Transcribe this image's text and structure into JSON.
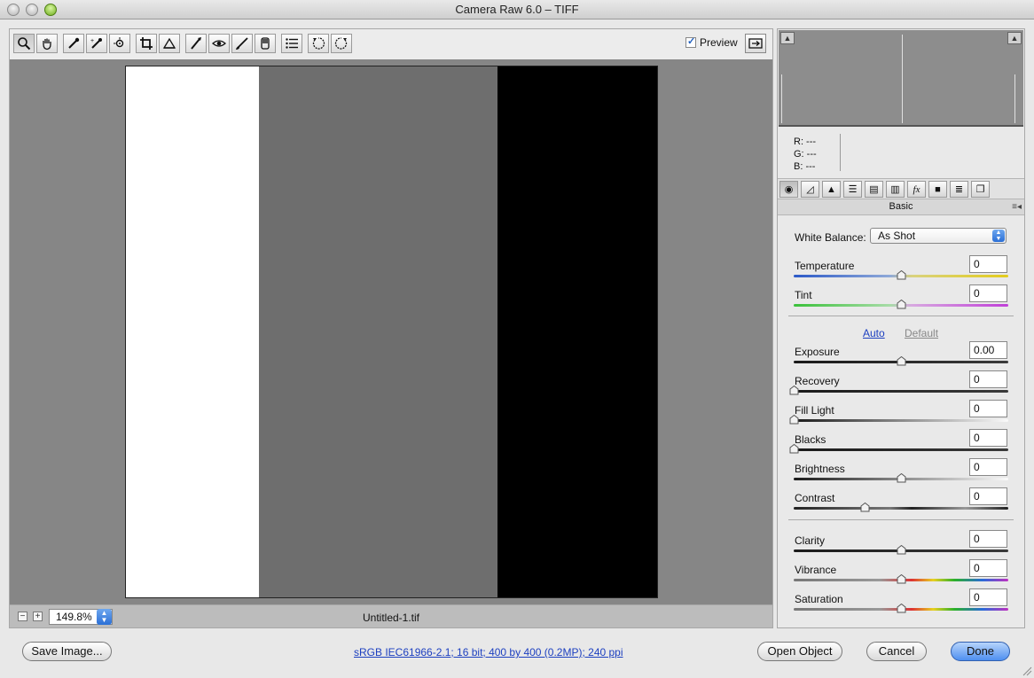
{
  "window": {
    "title": "Camera Raw 6.0  –  TIFF"
  },
  "toolbar": {
    "tools": [
      "zoom-icon",
      "hand-icon",
      "white-balance-icon",
      "color-sampler-icon",
      "targeted-adjustment-icon",
      "crop-icon",
      "straighten-icon",
      "spot-removal-icon",
      "red-eye-icon",
      "adjustment-brush-icon",
      "graduated-filter-icon",
      "preferences-icon",
      "rotate-ccw-icon",
      "rotate-cw-icon"
    ],
    "preview_label": "Preview",
    "preview_checked": true
  },
  "canvas": {
    "filename": "Untitled-1.tif",
    "zoom": "149.8%"
  },
  "histogram": {
    "r": "R:  ---",
    "g": "G:  ---",
    "b": "B:  ---"
  },
  "panel": {
    "title": "Basic",
    "tabs": [
      "basic-icon",
      "tone-curve-icon",
      "detail-icon",
      "hsl-icon",
      "split-toning-icon",
      "lens-corrections-icon",
      "effects-icon",
      "camera-calibration-icon",
      "presets-icon",
      "snapshots-icon"
    ],
    "white_balance_label": "White Balance:",
    "white_balance_value": "As Shot",
    "auto_label": "Auto",
    "default_label": "Default",
    "sliders": [
      {
        "key": "temperature",
        "label": "Temperature",
        "value": "0",
        "level": 0.5,
        "track": "temp"
      },
      {
        "key": "tint",
        "label": "Tint",
        "value": "0",
        "level": 0.5,
        "track": "tint"
      },
      {
        "key": "exposure",
        "label": "Exposure",
        "value": "0.00",
        "level": 0.5,
        "track": "dark"
      },
      {
        "key": "recovery",
        "label": "Recovery",
        "value": "0",
        "level": 0.0,
        "track": "dark"
      },
      {
        "key": "fill-light",
        "label": "Fill Light",
        "value": "0",
        "level": 0.0,
        "track": "light"
      },
      {
        "key": "blacks",
        "label": "Blacks",
        "value": "0",
        "level": 0.0,
        "track": "dark"
      },
      {
        "key": "brightness",
        "label": "Brightness",
        "value": "0",
        "level": 0.5,
        "track": "light"
      },
      {
        "key": "contrast",
        "label": "Contrast",
        "value": "0",
        "level": 0.33,
        "track": "contrast"
      },
      {
        "key": "clarity",
        "label": "Clarity",
        "value": "0",
        "level": 0.5,
        "track": "dark"
      },
      {
        "key": "vibrance",
        "label": "Vibrance",
        "value": "0",
        "level": 0.5,
        "track": "spectrum"
      },
      {
        "key": "saturation",
        "label": "Saturation",
        "value": "0",
        "level": 0.5,
        "track": "spectrum"
      }
    ]
  },
  "footer": {
    "save_label": "Save Image...",
    "info_link": "sRGB IEC61966-2.1; 16 bit; 400 by 400 (0.2MP); 240 ppi",
    "open_label": "Open Object",
    "cancel_label": "Cancel",
    "done_label": "Done"
  },
  "colors": {
    "accent": "#2b6fd6",
    "link": "#1c3fc0"
  }
}
